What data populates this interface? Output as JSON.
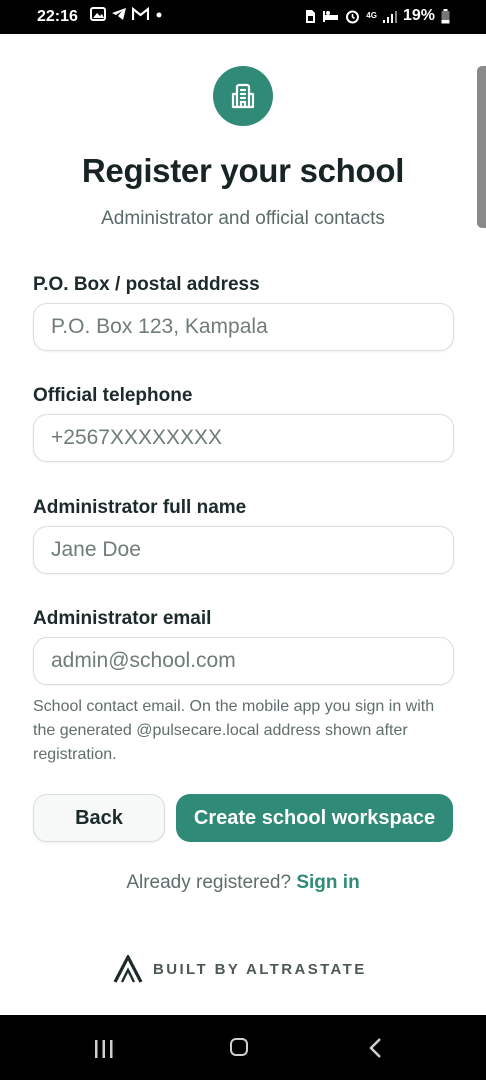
{
  "status": {
    "time": "22:16",
    "network": "4G",
    "battery": "19%"
  },
  "header": {
    "title": "Register your school",
    "subtitle": "Administrator and official contacts",
    "logo_icon": "school-building-icon"
  },
  "form": {
    "postal": {
      "label": "P.O. Box / postal address",
      "placeholder": "P.O. Box 123, Kampala"
    },
    "telephone": {
      "label": "Official telephone",
      "placeholder": "+2567XXXXXXXX"
    },
    "admin_name": {
      "label": "Administrator full name",
      "placeholder": "Jane Doe"
    },
    "admin_email": {
      "label": "Administrator email",
      "placeholder": "admin@school.com"
    },
    "hint": "School contact email. On the mobile app you sign in with the generated @pulsecare.local address shown after registration."
  },
  "actions": {
    "back_label": "Back",
    "create_label": "Create school workspace"
  },
  "footer": {
    "already_text": "Already registered?",
    "sign_in_label": "Sign in",
    "built_by": "BUILT BY ALTRASTATE"
  },
  "colors": {
    "accent": "#2f8a77",
    "text": "#172423",
    "muted": "#5f6e6c"
  }
}
